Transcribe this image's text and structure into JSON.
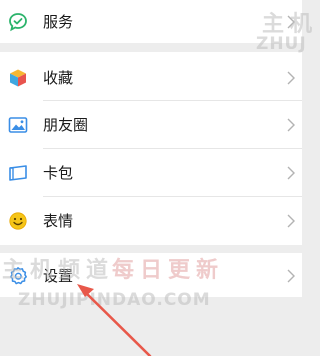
{
  "menu": {
    "services": {
      "label": "服务",
      "icon": "service-check-icon"
    },
    "favorites": {
      "label": "收藏",
      "icon": "favorites-cube-icon"
    },
    "moments": {
      "label": "朋友圈",
      "icon": "moments-picture-icon"
    },
    "cards": {
      "label": "卡包",
      "icon": "card-wallet-icon"
    },
    "stickers": {
      "label": "表情",
      "icon": "sticker-smiley-icon"
    },
    "settings": {
      "label": "设置",
      "icon": "settings-gear-icon"
    }
  },
  "watermark": {
    "brand_cn_top": "主机",
    "brand_url_top": "ZHUJ",
    "brand_cn": "主机频道",
    "slogan_cn": "每日更新",
    "brand_url": "ZHUJIPINDAO.COM"
  },
  "colors": {
    "background": "#ededed",
    "row": "#ffffff",
    "arrow": "#e8584a"
  }
}
